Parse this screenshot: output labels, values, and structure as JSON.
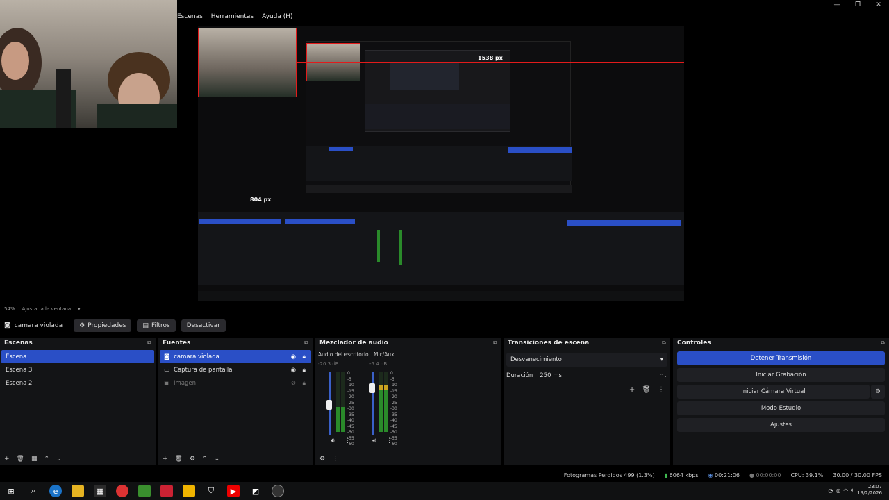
{
  "menu": [
    "Escenas",
    "Herramientas",
    "Ayuda (H)"
  ],
  "window_controls": [
    "—",
    "❐",
    "✕"
  ],
  "preview": {
    "width_label": "1538 px",
    "height_label": "804 px",
    "inner_width_label": "804 px"
  },
  "zoom": {
    "value": "54%",
    "fit_label": "Ajustar a la ventana"
  },
  "source_bar": {
    "source_name": "camara violada",
    "properties": "Propiedades",
    "filters": "Filtros",
    "deactivate": "Desactivar"
  },
  "scenes": {
    "title": "Escenas",
    "items": [
      "Escena",
      "Escena 3",
      "Escena 2"
    ]
  },
  "sources": {
    "title": "Fuentes",
    "items": [
      "camara violada",
      "Captura de pantalla",
      "Imagen"
    ]
  },
  "mixer": {
    "title": "Mezclador de audio",
    "channels": [
      {
        "name": "Audio del escritorio",
        "db": "-20.3 dB",
        "level": 0.42
      },
      {
        "name": "Mic/Aux",
        "db": "-5.4 dB",
        "level": 0.78
      }
    ],
    "scale": [
      "0",
      "-5",
      "-10",
      "-15",
      "-20",
      "-25",
      "-30",
      "-35",
      "-40",
      "-45",
      "-50",
      "-55",
      "-60"
    ]
  },
  "transitions": {
    "title": "Transiciones de escena",
    "selected": "Desvanecimiento",
    "duration_label": "Duración",
    "duration_value": "250 ms"
  },
  "controls": {
    "title": "Controles",
    "buttons": [
      "Detener Transmisión",
      "Iniciar Grabación",
      "Iniciar Cámara Virtual",
      "Modo Estudio",
      "Ajustes"
    ]
  },
  "status": {
    "dropped": "Fotogramas Perdidos 499 (1.3%)",
    "bitrate": "6064 kbps",
    "stream_time": "00:21:06",
    "rec_time": "00:00:00",
    "cpu": "CPU: 39.1%",
    "fps": "30.00 / 30.00 FPS"
  },
  "clock": {
    "time": "23:07",
    "date": "19/2/2026"
  },
  "colors": {
    "accent": "#2a4fc6",
    "redline": "#e21b1b",
    "bg": "#131416"
  }
}
